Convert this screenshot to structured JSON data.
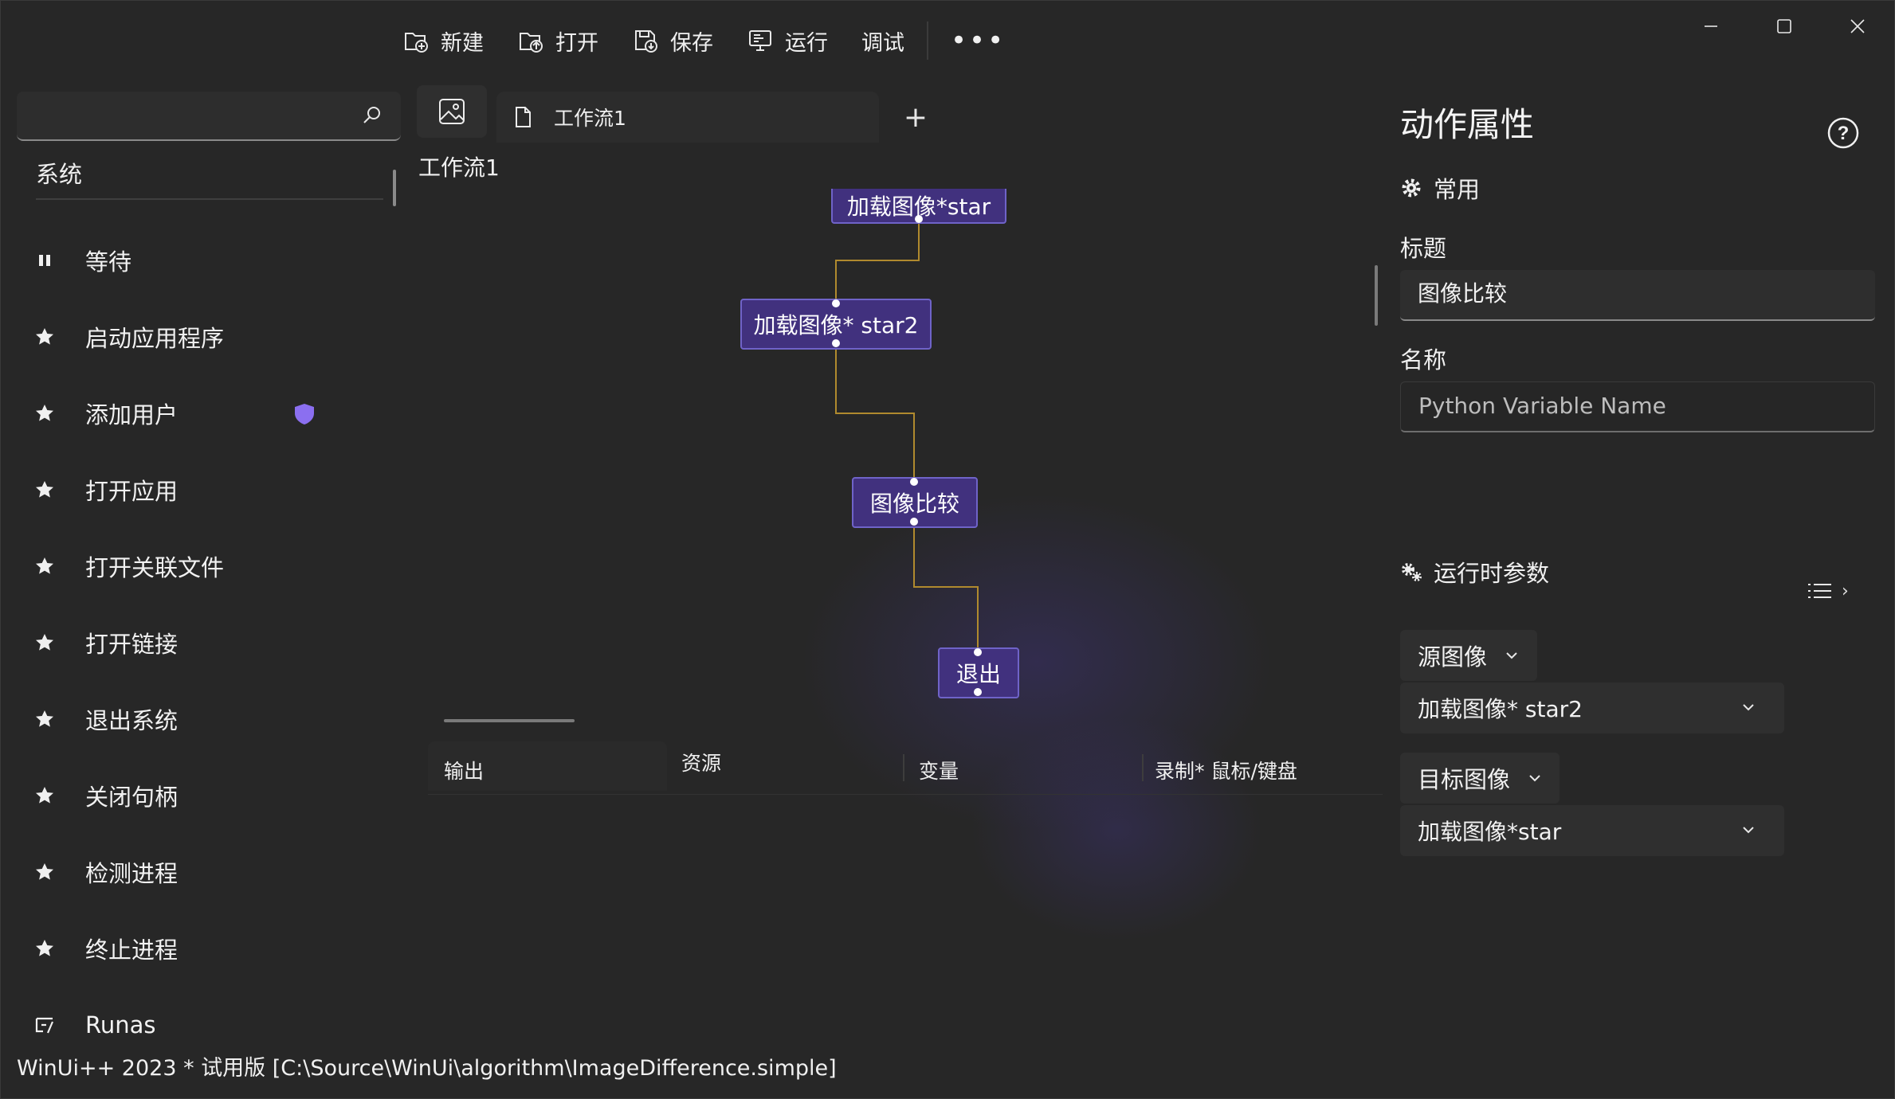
{
  "toolbar": {
    "new_label": "新建",
    "open_label": "打开",
    "save_label": "保存",
    "run_label": "运行",
    "debug_label": "调试",
    "more_label": "•••"
  },
  "sidebar": {
    "search_placeholder": "",
    "category": "系统",
    "items": [
      {
        "label": "等待",
        "icon": "pause-icon"
      },
      {
        "label": "启动应用程序",
        "icon": "star-icon"
      },
      {
        "label": "添加用户",
        "icon": "star-icon",
        "badge": "shield-icon"
      },
      {
        "label": "打开应用",
        "icon": "star-icon"
      },
      {
        "label": "打开关联文件",
        "icon": "star-icon"
      },
      {
        "label": "打开链接",
        "icon": "star-icon"
      },
      {
        "label": "退出系统",
        "icon": "star-icon"
      },
      {
        "label": "关闭句柄",
        "icon": "star-icon"
      },
      {
        "label": "检测进程",
        "icon": "star-icon"
      },
      {
        "label": "终止进程",
        "icon": "star-icon"
      },
      {
        "label": "Runas",
        "icon": "runas-icon"
      }
    ]
  },
  "tabs": {
    "image_tab_icon": "image-icon",
    "doc_tab_label": "工作流1",
    "add_label": "+"
  },
  "workflow": {
    "title": "工作流1",
    "nodes": [
      {
        "label": "加载图像*star"
      },
      {
        "label": "加载图像* star2"
      },
      {
        "label": "图像比较"
      },
      {
        "label": "退出"
      }
    ],
    "colors": {
      "node_fill": "#41317e",
      "node_border": "#6f63c8",
      "connector": "#b08a2e"
    }
  },
  "bottom_tabs": {
    "output": "输出",
    "resources": "资源",
    "variables": "变量",
    "record": "录制* 鼠标/键盘"
  },
  "status": {
    "text": "WinUi++ 2023 * 试用版 [C:\\Source\\WinUi\\algorithm\\ImageDifference.simple]"
  },
  "properties": {
    "title": "动作属性",
    "common_section": "常用",
    "title_label": "标题",
    "title_value": "图像比较",
    "name_label": "名称",
    "name_placeholder": "Python Variable Name",
    "runtime_section": "运行时参数",
    "source_label": "源图像",
    "source_value": "加载图像* star2",
    "target_label": "目标图像",
    "target_value": "加载图像*star"
  }
}
